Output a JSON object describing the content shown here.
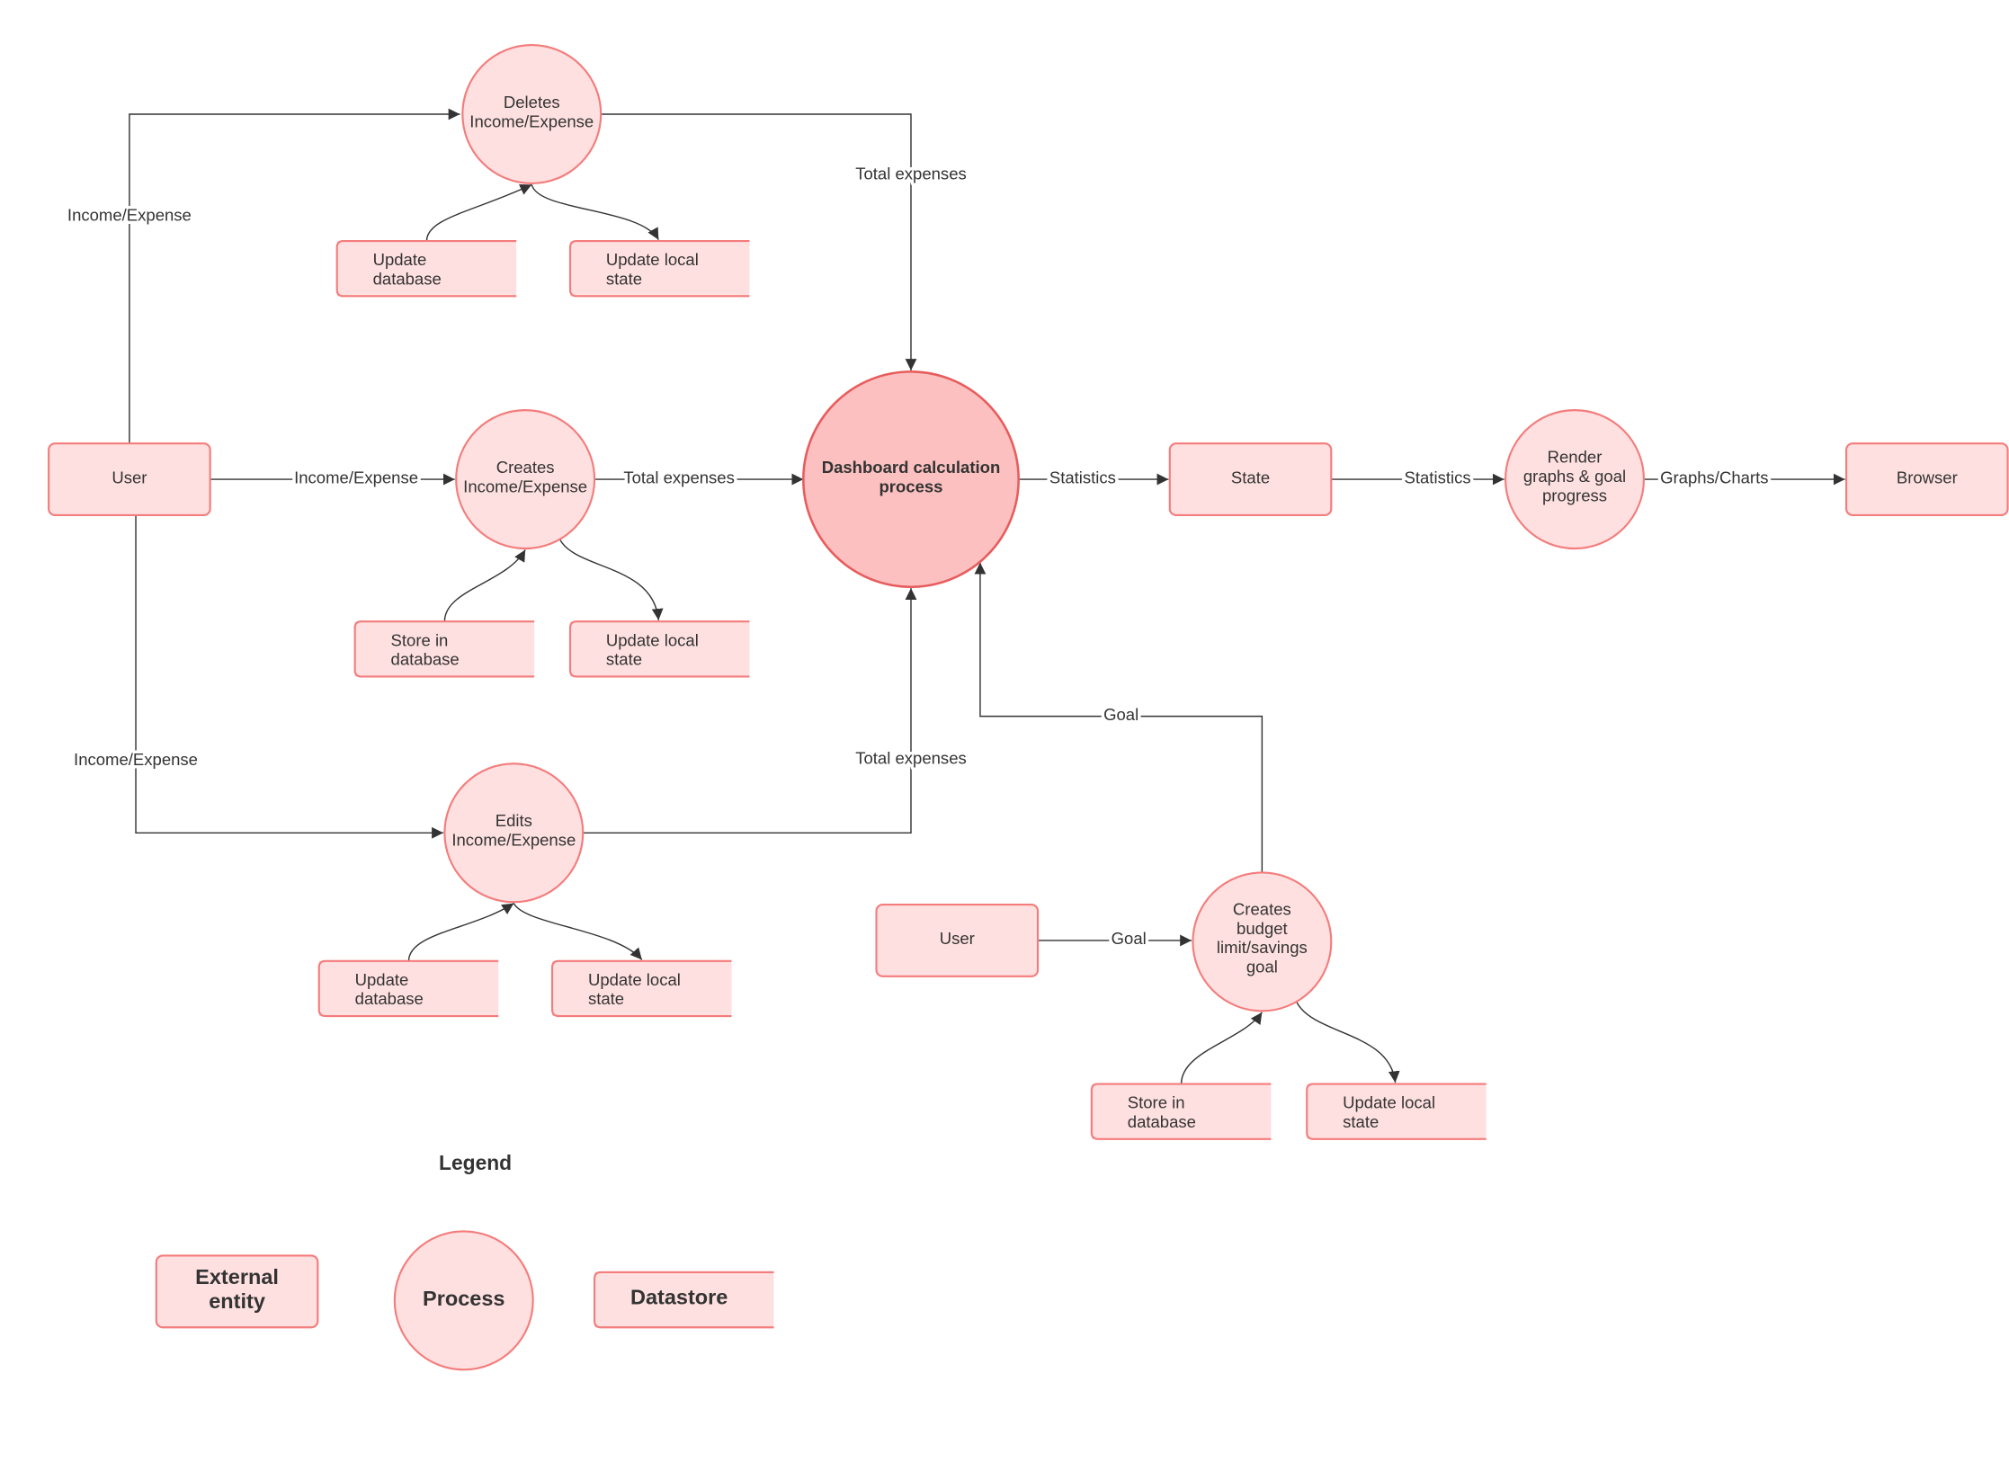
{
  "colors": {
    "process_fill": "#ffe0e0",
    "main_process_fill": "#fcc0c0",
    "border": "#f47c7c",
    "line": "#333333"
  },
  "nodes": {
    "deletes": {
      "lines": [
        "Deletes",
        "Income/Expense"
      ]
    },
    "creates": {
      "lines": [
        "Creates",
        "Income/Expense"
      ]
    },
    "edits": {
      "lines": [
        "Edits",
        "Income/Expense"
      ]
    },
    "dashboard": {
      "lines": [
        "Dashboard calculation",
        "process"
      ]
    },
    "render": {
      "lines": [
        "Render",
        "graphs & goal",
        "progress"
      ]
    },
    "budget": {
      "lines": [
        "Creates",
        "budget",
        "limit/savings",
        "goal"
      ]
    },
    "user": {
      "label": "User"
    },
    "user2": {
      "label": "User"
    },
    "state": {
      "label": "State"
    },
    "browser": {
      "label": "Browser"
    }
  },
  "datastores": {
    "del_db": [
      "Update",
      "database"
    ],
    "del_local": [
      "Update local",
      "state"
    ],
    "cre_db": [
      "Store in",
      "database"
    ],
    "cre_local": [
      "Update local",
      "state"
    ],
    "edit_db": [
      "Update",
      "database"
    ],
    "edit_local": [
      "Update local",
      "state"
    ],
    "bud_db": [
      "Store in",
      "database"
    ],
    "bud_local": [
      "Update local",
      "state"
    ]
  },
  "edges": {
    "user_deletes": "Income/Expense",
    "deletes_dashboard": "Total expenses",
    "user_creates": "Income/Expense",
    "creates_dashboard": "Total expenses",
    "user_edits": "Income/Expense",
    "edits_dashboard": "Total expenses",
    "dashboard_state": "Statistics",
    "state_render": "Statistics",
    "render_browser": "Graphs/Charts",
    "budget_dashboard": "Goal",
    "user2_budget": "Goal"
  },
  "legend": {
    "title": "Legend",
    "external_entity": [
      "External",
      "entity"
    ],
    "process": "Process",
    "datastore": "Datastore"
  }
}
